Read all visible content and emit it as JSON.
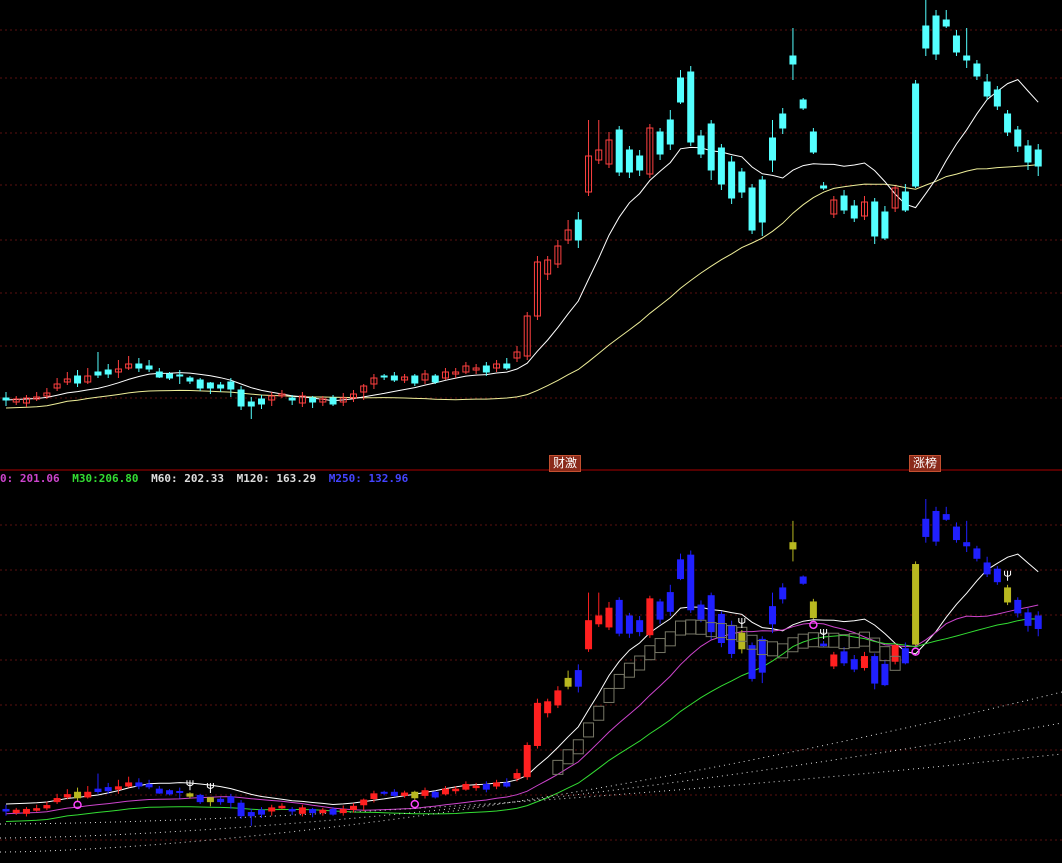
{
  "badges": {
    "b1": "财激",
    "b2": "涨榜"
  },
  "ma_legend": [
    {
      "label": "0:",
      "value": "201.06",
      "color": "#cc44cc"
    },
    {
      "label": "M30:",
      "value": "206.80",
      "color": "#33dd33"
    },
    {
      "label": "M60:",
      "value": "202.33",
      "color": "#dddddd"
    },
    {
      "label": "M120:",
      "value": "163.29",
      "color": "#dddddd"
    },
    {
      "label": "M250:",
      "value": "132.96",
      "color": "#4444ff"
    }
  ],
  "colors": {
    "up": "#ff4040",
    "down": "#54ffff",
    "grid": "#5a1010",
    "divider": "#aa0000",
    "ma_short": "#ffffff",
    "ma_long": "#eeee99",
    "lower_up": "#ff2020",
    "lower_down": "#2020ff",
    "lower_signal": "#b8b820",
    "lower_magenta": "#cc44cc",
    "lower_green": "#33dd33"
  },
  "chart_data": {
    "type": "candlestick",
    "candles": [
      [
        398,
        400,
        392,
        406
      ],
      [
        402,
        399,
        396,
        405
      ],
      [
        403,
        398,
        395,
        407
      ],
      [
        399,
        397,
        392,
        401
      ],
      [
        396,
        393,
        388,
        399
      ],
      [
        388,
        384,
        378,
        391
      ],
      [
        382,
        379,
        372,
        385
      ],
      [
        376,
        383,
        370,
        387
      ],
      [
        382,
        376,
        368,
        384
      ],
      [
        372,
        375,
        352,
        378
      ],
      [
        370,
        374,
        364,
        378
      ],
      [
        372,
        369,
        360,
        378
      ],
      [
        368,
        364,
        356,
        370
      ],
      [
        364,
        368,
        358,
        372
      ],
      [
        366,
        369,
        360,
        372
      ],
      [
        372,
        377,
        368,
        378
      ],
      [
        374,
        378,
        372,
        380
      ],
      [
        375,
        376,
        370,
        384
      ],
      [
        378,
        381,
        376,
        384
      ],
      [
        380,
        388,
        378,
        391
      ],
      [
        383,
        388,
        382,
        394
      ],
      [
        385,
        388,
        382,
        392
      ],
      [
        382,
        389,
        378,
        397
      ],
      [
        390,
        406,
        386,
        410
      ],
      [
        402,
        406,
        397,
        419
      ],
      [
        399,
        404,
        395,
        409
      ],
      [
        400,
        396,
        392,
        406
      ],
      [
        396,
        394,
        390,
        398
      ],
      [
        398,
        400,
        395,
        405
      ],
      [
        403,
        396,
        392,
        407
      ],
      [
        398,
        402,
        396,
        408
      ],
      [
        402,
        399,
        396,
        406
      ],
      [
        398,
        404,
        395,
        406
      ],
      [
        402,
        398,
        393,
        406
      ],
      [
        398,
        394,
        390,
        402
      ],
      [
        392,
        386,
        384,
        400
      ],
      [
        384,
        378,
        374,
        389
      ],
      [
        376,
        377,
        374,
        380
      ],
      [
        376,
        380,
        372,
        382
      ],
      [
        380,
        377,
        374,
        383
      ],
      [
        376,
        383,
        374,
        386
      ],
      [
        380,
        374,
        370,
        384
      ],
      [
        376,
        382,
        374,
        384
      ],
      [
        378,
        372,
        368,
        380
      ],
      [
        374,
        372,
        368,
        378
      ],
      [
        372,
        366,
        362,
        374
      ],
      [
        370,
        368,
        364,
        374
      ],
      [
        366,
        372,
        362,
        376
      ],
      [
        368,
        364,
        360,
        372
      ],
      [
        364,
        368,
        358,
        370
      ],
      [
        358,
        352,
        346,
        362
      ],
      [
        356,
        316,
        312,
        360
      ],
      [
        316,
        262,
        256,
        320
      ],
      [
        274,
        260,
        256,
        280
      ],
      [
        264,
        246,
        240,
        268
      ],
      [
        240,
        230,
        220,
        244
      ],
      [
        220,
        240,
        212,
        248
      ],
      [
        192,
        156,
        120,
        196
      ],
      [
        160,
        150,
        120,
        164
      ],
      [
        164,
        140,
        132,
        168
      ],
      [
        130,
        172,
        126,
        176
      ],
      [
        150,
        172,
        146,
        178
      ],
      [
        156,
        170,
        150,
        176
      ],
      [
        174,
        128,
        124,
        178
      ],
      [
        132,
        154,
        128,
        160
      ],
      [
        120,
        144,
        110,
        150
      ],
      [
        78,
        102,
        70,
        104
      ],
      [
        72,
        142,
        66,
        146
      ],
      [
        136,
        154,
        130,
        158
      ],
      [
        124,
        170,
        120,
        180
      ],
      [
        148,
        184,
        144,
        190
      ],
      [
        162,
        198,
        156,
        204
      ],
      [
        172,
        192,
        168,
        198
      ],
      [
        188,
        230,
        184,
        234
      ],
      [
        180,
        222,
        176,
        236
      ],
      [
        138,
        160,
        120,
        172
      ],
      [
        114,
        128,
        108,
        134
      ],
      [
        56,
        64,
        28,
        80
      ],
      [
        100,
        108,
        98,
        110
      ],
      [
        132,
        152,
        128,
        154
      ],
      [
        186,
        188,
        182,
        190
      ],
      [
        214,
        200,
        196,
        218
      ],
      [
        196,
        210,
        190,
        214
      ],
      [
        206,
        218,
        200,
        222
      ],
      [
        216,
        202,
        196,
        220
      ],
      [
        202,
        236,
        198,
        244
      ],
      [
        212,
        238,
        206,
        240
      ],
      [
        208,
        188,
        186,
        212
      ],
      [
        192,
        210,
        184,
        212
      ],
      [
        84,
        186,
        80,
        188
      ],
      [
        26,
        48,
        0,
        56
      ],
      [
        16,
        54,
        10,
        60
      ],
      [
        20,
        26,
        10,
        28
      ],
      [
        36,
        52,
        30,
        56
      ],
      [
        56,
        60,
        28,
        68
      ],
      [
        64,
        76,
        60,
        80
      ],
      [
        82,
        96,
        74,
        100
      ],
      [
        90,
        106,
        86,
        110
      ],
      [
        114,
        132,
        110,
        136
      ],
      [
        130,
        146,
        126,
        152
      ],
      [
        146,
        162,
        140,
        170
      ],
      [
        150,
        166,
        144,
        176
      ]
    ]
  }
}
